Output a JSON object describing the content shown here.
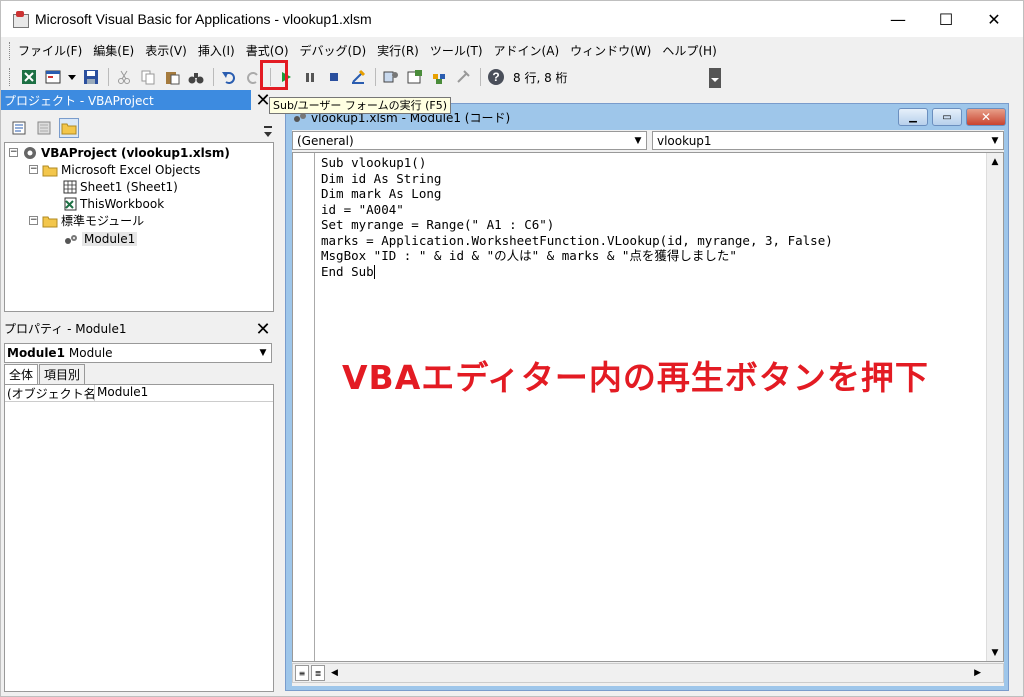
{
  "window": {
    "title": "Microsoft Visual Basic for Applications - vlookup1.xlsm",
    "minimize": "—",
    "maximize": "☐",
    "close": "✕"
  },
  "menu": [
    "ファイル(F)",
    "編集(E)",
    "表示(V)",
    "挿入(I)",
    "書式(O)",
    "デバッグ(D)",
    "実行(R)",
    "ツール(T)",
    "アドイン(A)",
    "ウィンドウ(W)",
    "ヘルプ(H)"
  ],
  "toolbar": {
    "position": "8 行, 8 桁",
    "run_tooltip": "Sub/ユーザー フォームの実行 (F5)"
  },
  "project_panel": {
    "title": "プロジェクト - VBAProject",
    "tree": {
      "root": "VBAProject (vlookup1.xlsm)",
      "folder_objects": "Microsoft Excel Objects",
      "sheet1": "Sheet1 (Sheet1)",
      "workbook": "ThisWorkbook",
      "folder_modules": "標準モジュール",
      "module1": "Module1"
    }
  },
  "properties_panel": {
    "title": "プロパティ - Module1",
    "object_name": "Module1",
    "object_type": "Module",
    "tab_all": "全体",
    "tab_category": "項目別",
    "row_key": "(オブジェクト名)",
    "row_value": "Module1"
  },
  "code_window": {
    "title": "vlookup1.xlsm - Module1 (コード)",
    "object_combo": "(General)",
    "proc_combo": "vlookup1",
    "lines": [
      "Sub vlookup1()",
      "Dim id As String",
      "Dim mark As Long",
      "id = \"A004\"",
      "Set myrange = Range(\" A1 : C6\")",
      "marks = Application.WorksheetFunction.VLookup(id, myrange, 3, False)",
      "MsgBox \"ID : \" & id & \"の人は\" & marks & \"点を獲得しました\"",
      "End Sub"
    ]
  },
  "annotation": "VBAエディター内の再生ボタンを押下",
  "colors": {
    "accent_red": "#e31b23",
    "panel_header_blue": "#3d8be0",
    "mdi_frame": "#9ec6ea"
  }
}
